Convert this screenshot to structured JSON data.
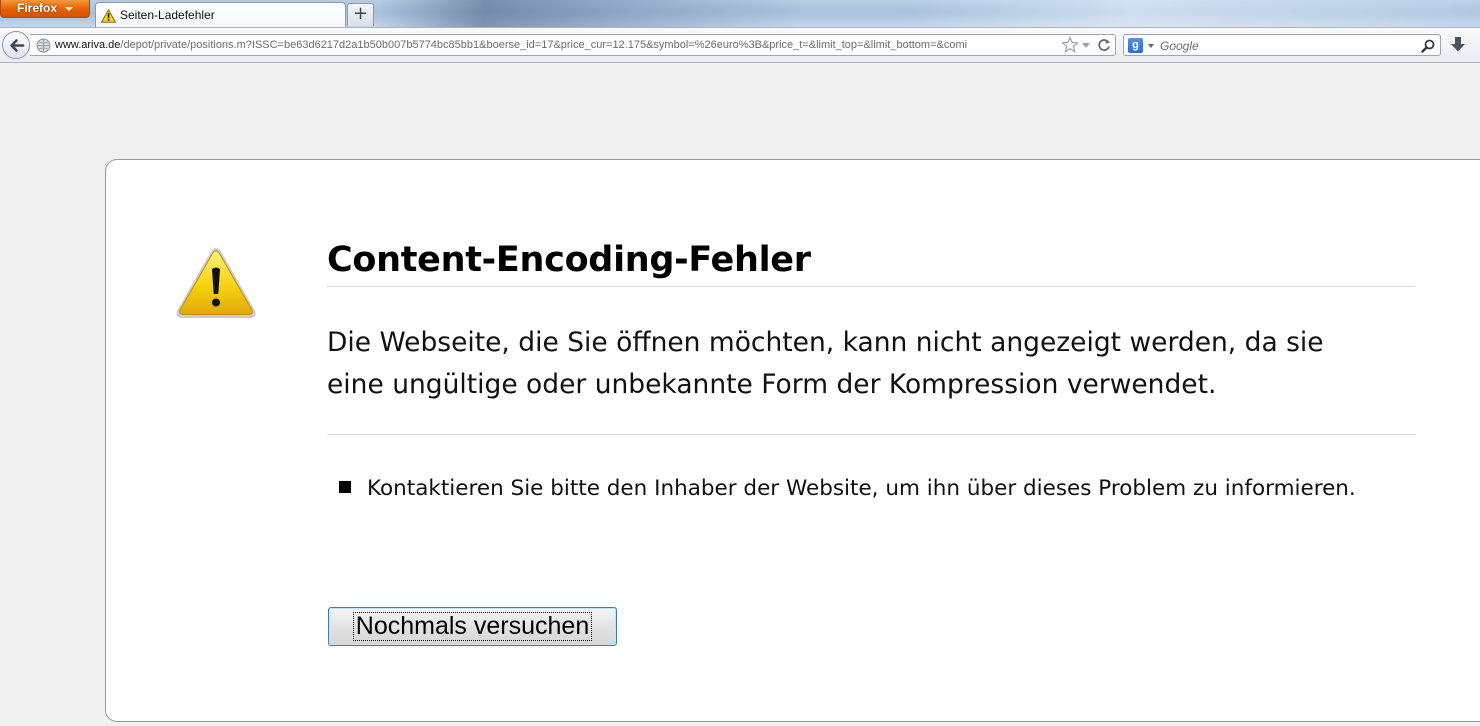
{
  "browser": {
    "menu_button_label": "Firefox",
    "tab": {
      "title": "Seiten-Ladefehler",
      "icon": "warning-icon"
    },
    "new_tab_label": "+",
    "url": {
      "scheme_host": "www.ariva.de",
      "path": "/depot/private/positions.m?ISSC=be63d6217d2a1b50b007b5774bc85bb1&boerse_id=17&price_cur=12.175&symbol=%26euro%3B&price_t=&limit_top=&limit_bottom=&comi"
    },
    "search": {
      "engine_icon": "google-icon",
      "placeholder": "Google"
    }
  },
  "error_page": {
    "icon": "warning-icon",
    "title": "Content-Encoding-Fehler",
    "description": "Die Webseite, die Sie öffnen möchten, kann nicht angezeigt werden, da sie eine ungültige oder unbekannte Form der Kompression verwendet.",
    "suggestions": [
      "Kontaktieren Sie bitte den Inhaber der Website, um ihn über dieses Problem zu informieren."
    ],
    "retry_button_label": "Nochmals versuchen"
  },
  "colors": {
    "firefox_button": "#e66000",
    "focus_border": "#3c7fb1",
    "warning_yellow": "#f5d10f"
  }
}
